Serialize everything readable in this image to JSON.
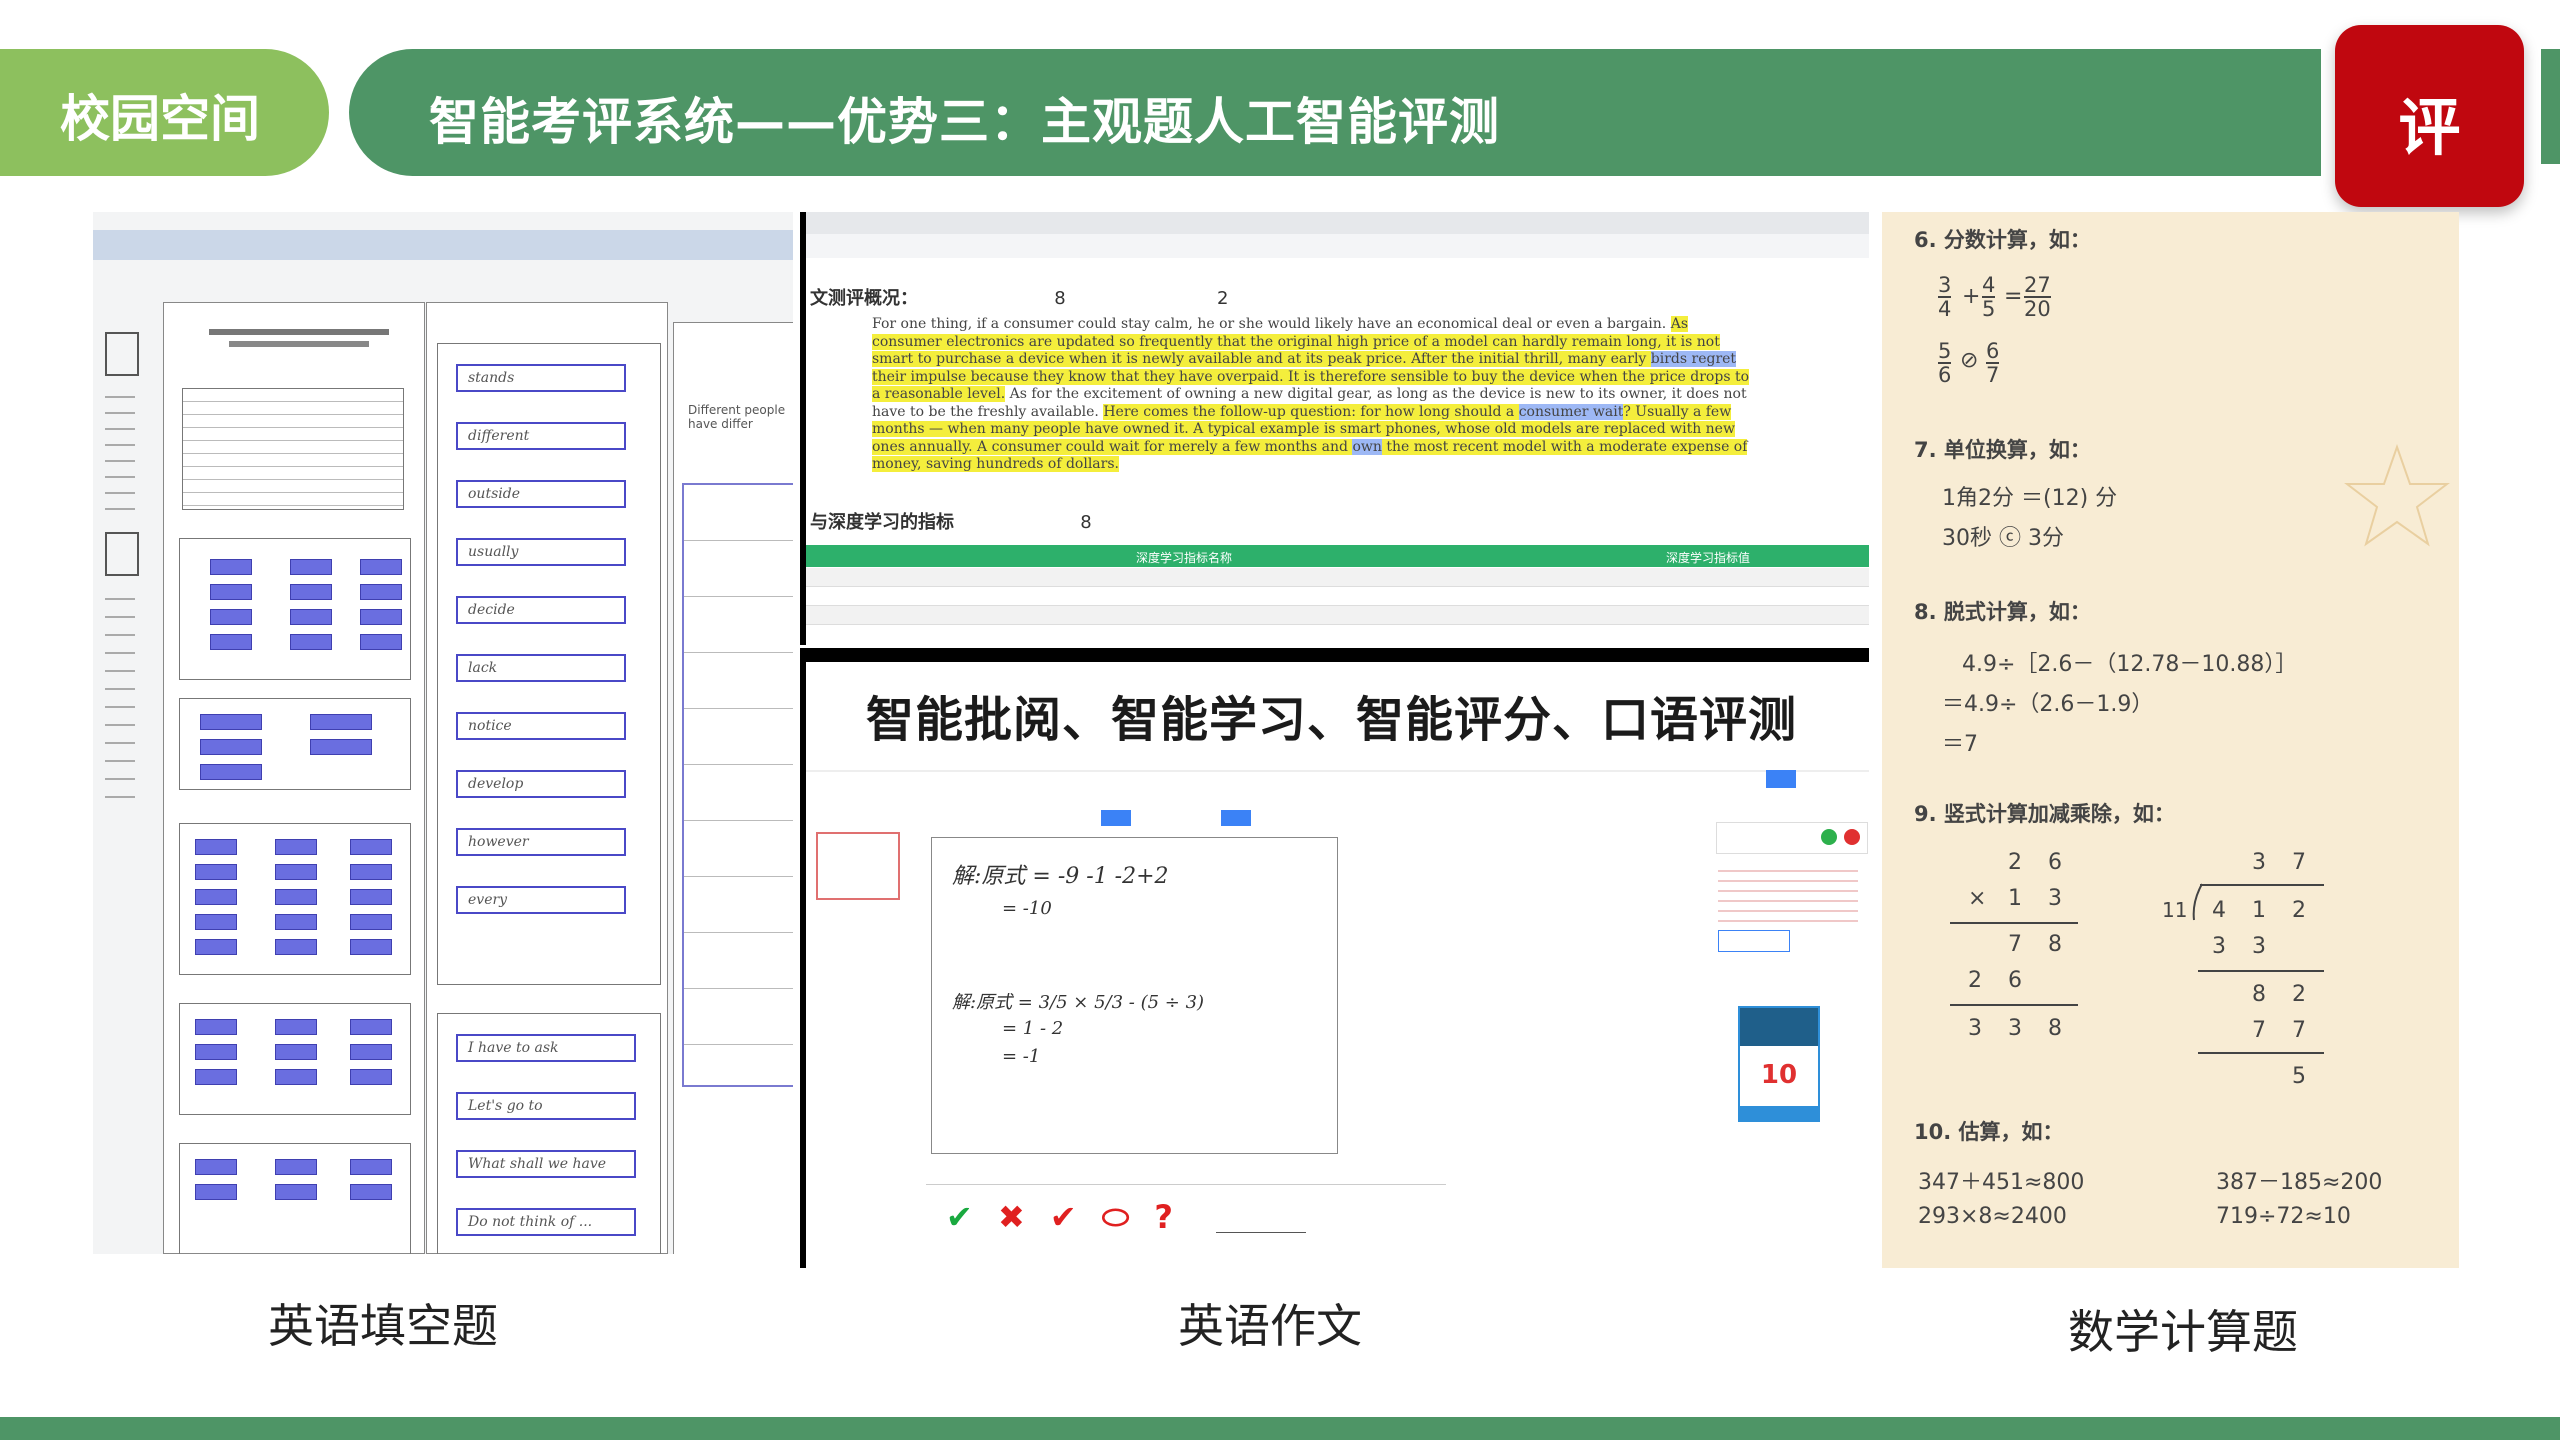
{
  "header": {
    "tag": "校园空间",
    "title": "智能考评系统——优势三：主观题人工智能评测",
    "badge": "评"
  },
  "captions": {
    "left": "英语填空题",
    "middle": "英语作文",
    "right": "数学计算题"
  },
  "panel_fill": {
    "student_answers": [
      "stands",
      "different",
      "outside",
      "usually",
      "decide",
      "lack",
      "notice",
      "develop",
      "however",
      "every"
    ],
    "lower_answers": [
      "I have to ask",
      "Let's go to",
      "What shall we have",
      "Do not think of ..."
    ],
    "right_side_word": "Different people have differ"
  },
  "panel_essay": {
    "section1_label": "文测评概况：",
    "section1_score": "8",
    "section1_score2": "2",
    "essay_plain_1": "For one thing, if a consumer could stay calm, he or she would likely have an economical deal or even a bargain. ",
    "essay_hl_1": "As consumer electronics are updated so frequently that the original high price of a model can hardly remain long, it is not smart to purchase a device when it is newly available and at its peak price. After the initial thrill, many early ",
    "essay_hlb_1": "birds regret",
    "essay_hl_2": " their impulse because they know that they have overpaid. It is therefore sensible to buy the device when the price drops to a reasonable level.",
    "essay_plain_2": " As for the excitement of owning a new digital gear, as long as the device is new to its owner, it does not have to be the freshly available. ",
    "essay_hl_3": "Here comes the follow-up question: for how long should a ",
    "essay_hlb_2": "consumer wait",
    "essay_hl_4": "? Usually a few months — when many people have owned it. A typical example is smart phones, whose old models are replaced with new ones annually. A consumer could wait for merely a few months and ",
    "essay_hlb_3": "own",
    "essay_hl_5": " the most recent model with a moderate expense of money, saving hundreds of dollars.",
    "section2_label": "与深度学习的指标",
    "section2_score": "8",
    "table_headers": [
      "深度学习指标名称",
      "深度学习指标值"
    ]
  },
  "panel_grading": {
    "headline": "智能批阅、智能学习、智能评分、口语评测",
    "score": "10",
    "toolbar_marks": [
      "✔",
      "✖",
      "✔",
      "⬭",
      "?"
    ],
    "work_lines": [
      "解:原式 = -9 -1 -2+2",
      "= -10",
      "解:原式 = 3/5 × 5/3 - (5 ÷ 3)",
      "= 1 - 2",
      "= -1"
    ]
  },
  "panel_math": {
    "sections": [
      {
        "heading": "6. 分数计算，如："
      },
      {
        "heading": "7. 单位换算，如：",
        "lines": [
          "1角2分 ＝(12) 分",
          "30秒 ⓒ 3分"
        ]
      },
      {
        "heading": "8. 脱式计算，如：",
        "lines": [
          "4.9÷［2.6－（12.78－10.88）］",
          "＝4.9÷（2.6－1.9）",
          "＝7"
        ]
      },
      {
        "heading": "9. 竖式计算加减乘除，如："
      },
      {
        "heading": "10. 估算，如：",
        "lines": [
          "347＋451≈800",
          "387－185≈200",
          "293×8≈2400",
          "719÷72≈10"
        ]
      }
    ],
    "fractions": {
      "a_num": "3",
      "a_den": "4",
      "b_num": "4",
      "b_den": "5",
      "c_num": "27",
      "c_den": "20",
      "d_num": "5",
      "d_den": "6",
      "e_num": "6",
      "e_den": "7",
      "plus": "+",
      "equals": "=",
      "compare": "⊘"
    },
    "mult": {
      "top": [
        "2",
        "6"
      ],
      "mul": [
        "×",
        "1",
        "3"
      ],
      "r1": [
        "7",
        "8"
      ],
      "r2": [
        "2",
        "6"
      ],
      "sum": [
        "3",
        "3",
        "8"
      ]
    },
    "div": {
      "quotient": [
        "3",
        "7"
      ],
      "divisor": "11",
      "dividend": [
        "4",
        "1",
        "2"
      ],
      "s1": [
        "3",
        "3"
      ],
      "r1": [
        "8",
        "2"
      ],
      "s2": [
        "7",
        "7"
      ],
      "rem": "5"
    }
  }
}
